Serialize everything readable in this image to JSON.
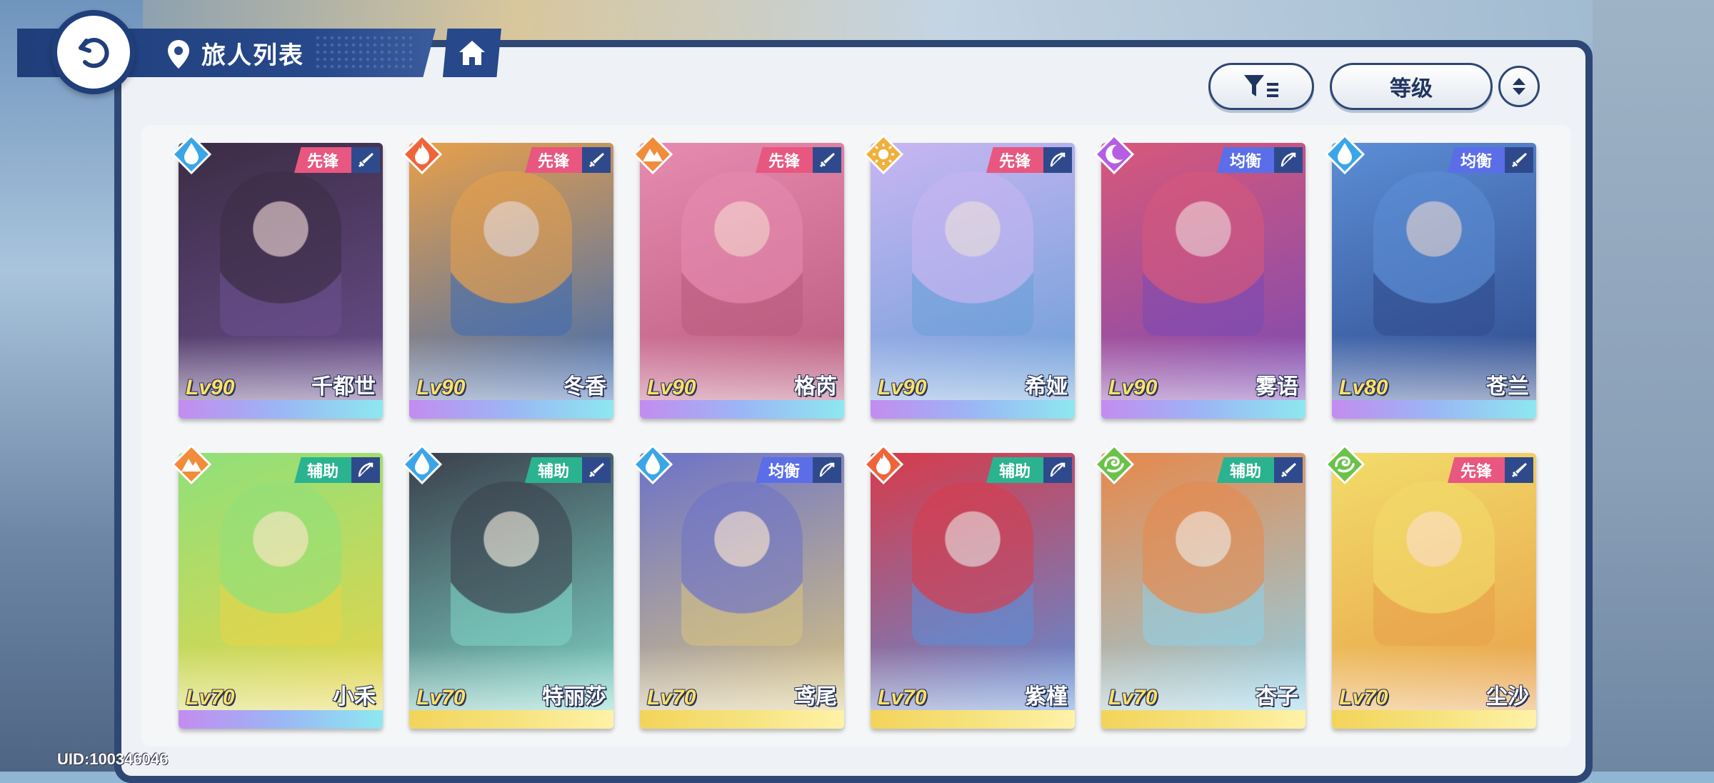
{
  "header": {
    "title": "旅人列表"
  },
  "toolbar": {
    "sort_label": "等级"
  },
  "uid_text": "UID:100346046",
  "role_colors": {
    "先锋": "#e8577f",
    "均衡": "#5b6ee8",
    "辅助": "#2bb38f"
  },
  "element_colors": {
    "water": "#3aa6e8",
    "fire": "#f0643a",
    "earth": "#f08c3a",
    "light": "#f0b03a",
    "dark": "#b45ee0",
    "wind": "#6ac24a"
  },
  "characters": [
    {
      "name": "千都世",
      "level": "Lv90",
      "role": "先锋",
      "weapon": "sword-icon",
      "element": "water",
      "art": [
        "#3b2c44",
        "#6b4f8e"
      ],
      "bottom": "purple"
    },
    {
      "name": "冬香",
      "level": "Lv90",
      "role": "先锋",
      "weapon": "sword-icon",
      "element": "fire",
      "art": [
        "#e8a04a",
        "#3d6bb3"
      ],
      "bottom": "purple"
    },
    {
      "name": "格芮",
      "level": "Lv90",
      "role": "先锋",
      "weapon": "sword-icon",
      "element": "earth",
      "art": [
        "#e78bb0",
        "#b85a7c"
      ],
      "bottom": "purple"
    },
    {
      "name": "希娅",
      "level": "Lv90",
      "role": "先锋",
      "weapon": "bow-icon",
      "element": "light",
      "art": [
        "#c9b6f2",
        "#6a9fd8"
      ],
      "bottom": "purple"
    },
    {
      "name": "雾语",
      "level": "Lv90",
      "role": "均衡",
      "weapon": "bow-icon",
      "element": "dark",
      "art": [
        "#d8587a",
        "#7a4ab3"
      ],
      "bottom": "purple"
    },
    {
      "name": "苍兰",
      "level": "Lv80",
      "role": "均衡",
      "weapon": "sword-icon",
      "element": "water",
      "art": [
        "#5c8ed6",
        "#2f4a8c"
      ],
      "bottom": "purple"
    },
    {
      "name": "小禾",
      "level": "Lv70",
      "role": "辅助",
      "weapon": "bow-icon",
      "element": "earth",
      "art": [
        "#8fe07a",
        "#e8d448"
      ],
      "bottom": "purple"
    },
    {
      "name": "特丽莎",
      "level": "Lv70",
      "role": "辅助",
      "weapon": "sword-icon",
      "element": "water",
      "art": [
        "#3a3f4c",
        "#7fd6c8"
      ],
      "bottom": "gold"
    },
    {
      "name": "鸢尾",
      "level": "Lv70",
      "role": "均衡",
      "weapon": "bow-icon",
      "element": "water",
      "art": [
        "#6c72c8",
        "#d8c480"
      ],
      "bottom": "gold"
    },
    {
      "name": "紫槿",
      "level": "Lv70",
      "role": "辅助",
      "weapon": "bow-icon",
      "element": "fire",
      "art": [
        "#d83a4a",
        "#5b8fd8"
      ],
      "bottom": "gold"
    },
    {
      "name": "杏子",
      "level": "Lv70",
      "role": "辅助",
      "weapon": "sword-icon",
      "element": "wind",
      "art": [
        "#e8884a",
        "#8fd0e8"
      ],
      "bottom": "gold"
    },
    {
      "name": "尘沙",
      "level": "Lv70",
      "role": "先锋",
      "weapon": "sword-icon",
      "element": "wind",
      "art": [
        "#f2dc6a",
        "#e8a04a"
      ],
      "bottom": "gold"
    }
  ]
}
